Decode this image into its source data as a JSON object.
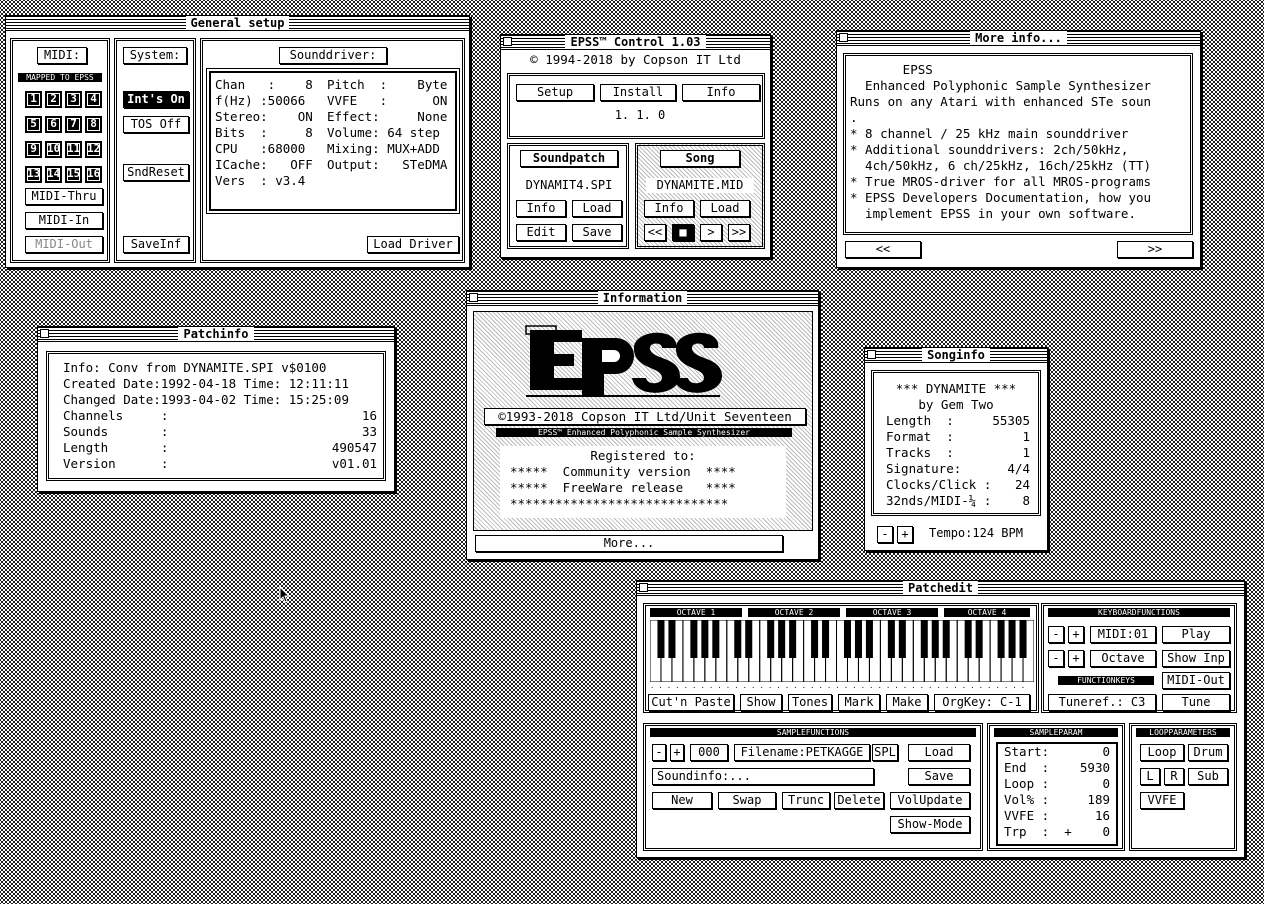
{
  "general_setup": {
    "title": "General setup",
    "midi": {
      "label": "MIDI:",
      "mapped": "MAPPED TO EPSS",
      "channels": [
        "1",
        "2",
        "3",
        "4",
        "5",
        "6",
        "7",
        "8",
        "9",
        "10",
        "11",
        "12",
        "13",
        "14",
        "15",
        "16"
      ],
      "thru": "MIDI-Thru",
      "in": "MIDI-In",
      "out": "MIDI-Out"
    },
    "system": {
      "label": "System:",
      "ints_on": "Int's On",
      "tos_off": "TOS Off",
      "sndreset": "SndReset",
      "saveinf": "SaveInf"
    },
    "sounddriver": {
      "label": "Sounddriver:",
      "rows": [
        "Chan   :    8",
        "f(Hz) :50066",
        "Stereo:    ON",
        "Bits  :     8",
        "CPU   :68000",
        "ICache:   OFF",
        "Vers  : v3.4"
      ],
      "rows2": [
        "Pitch  :    Byte",
        "VVFE   :      ON",
        "Effect:     None",
        "Volume: 64 step",
        "Mixing: MUX+ADD",
        "Output:   STeDMA"
      ],
      "load_driver": "Load Driver"
    }
  },
  "control": {
    "title": "EPSS™ Control 1.03",
    "copyright": "© 1994-2018 by Copson IT Ltd",
    "setup": "Setup",
    "install": "Install",
    "info": "Info",
    "version": "1. 1.  0",
    "soundpatch": "Soundpatch",
    "song": "Song",
    "patch_file": "DYNAMIT4.SPI",
    "song_file": "DYNAMITE.MID",
    "info_btn": "Info",
    "load_btn": "Load",
    "edit_btn": "Edit",
    "save_btn": "Save",
    "rew": "<<",
    "stop": "■",
    "play": ">",
    "ff": ">>"
  },
  "more_info": {
    "title": "More info...",
    "lines": [
      "       EPSS",
      "  Enhanced Polyphonic Sample Synthesizer",
      "Runs on any Atari with enhanced STe soun",
      ".",
      "* 8 channel / 25 kHz main sounddriver",
      "* Additional sounddrivers: 2ch/50kHz,",
      "  4ch/50kHz, 6 ch/25kHz, 16ch/25kHz (TT)",
      "* True MROS-driver for all MROS-programs",
      "* EPSS Developers Documentation, how you",
      "  implement EPSS in your own software."
    ],
    "prev": "<<",
    "next": ">>"
  },
  "patchinfo": {
    "title": "Patchinfo",
    "lines": [
      [
        "Info: Conv from DYNAMITE.SPI v$0100",
        ""
      ],
      [
        "Created Date:1992-04-18 Time: 12:11:11",
        ""
      ],
      [
        "Changed Date:1993-04-02 Time: 15:25:09",
        ""
      ],
      [
        "Channels     :",
        "16"
      ],
      [
        "Sounds       :",
        "33"
      ],
      [
        "Length       :",
        "490547"
      ],
      [
        "Version      :",
        "v01.01"
      ]
    ]
  },
  "information": {
    "title": "Information",
    "logo": "EPSS",
    "copyright": "©1993-2018 Copson IT Ltd/Unit Seventeen",
    "subtitle": "EPSS™ Enhanced Polyphonic Sample Synthesizer",
    "registered": "Registered to:",
    "line1": "*****  Community version  ****",
    "line2": "*****  FreeWare release   ****",
    "line3": "*****************************",
    "more": "More..."
  },
  "songinfo": {
    "title": "Songinfo",
    "name": "*** DYNAMITE ***",
    "by": "by Gem Two",
    "rows": [
      [
        "Length  :",
        "55305"
      ],
      [
        "Format  :",
        "1"
      ],
      [
        "Tracks  :",
        "1"
      ],
      [
        "Signature:",
        "4/4"
      ],
      [
        "Clocks/Click :",
        "24"
      ],
      [
        "32nds/MIDI-¼ :",
        "8"
      ]
    ],
    "minus": "-",
    "plus": "+",
    "tempo": "Tempo:124 BPM"
  },
  "patchedit": {
    "title": "Patchedit",
    "octaves": [
      "OCTAVE 1",
      "OCTAVE 2",
      "OCTAVE 3",
      "OCTAVE 4"
    ],
    "keyboard_label": "KEYBOARDFUNCTIONS",
    "midi_ch": "MIDI:01",
    "play": "Play",
    "octave": "Octave",
    "show_inp": "Show Inp",
    "midi_out": "MIDI-Out",
    "functions_label": "FUNCTIONKEYS",
    "cut": "Cut'n Paste",
    "show": "Show",
    "tones": "Tones",
    "mark": "Mark",
    "make": "Make",
    "orgkey": "OrgKey: C-1",
    "tuneref": "Tuneref.:  C3",
    "tune": "Tune",
    "sample_label": "SAMPLEFUNCTIONS",
    "num": "000",
    "filename": "Filename:PETKAGGE",
    "spl": "SPL",
    "load": "Load",
    "soundinfo": "Soundinfo:...",
    "save": "Save",
    "new": "New",
    "swap": "Swap",
    "trunc": "Trunc",
    "delete": "Delete",
    "volupdate": "VolUpdate",
    "showmode": "Show-Mode",
    "params_label": "SAMPLEPARAM",
    "params": [
      [
        "Start:",
        "0"
      ],
      [
        "End  :",
        "5930"
      ],
      [
        "Loop :",
        "0"
      ],
      [
        "Vol% :",
        "189"
      ],
      [
        "VVFE :",
        "16"
      ],
      [
        "Trp  :  +",
        "0"
      ]
    ],
    "loop_label": "LOOPPARAMETERS",
    "loop": "Loop",
    "drum": "Drum",
    "l": "L",
    "r": "R",
    "sub": "Sub",
    "vvfe": "VVFE"
  }
}
